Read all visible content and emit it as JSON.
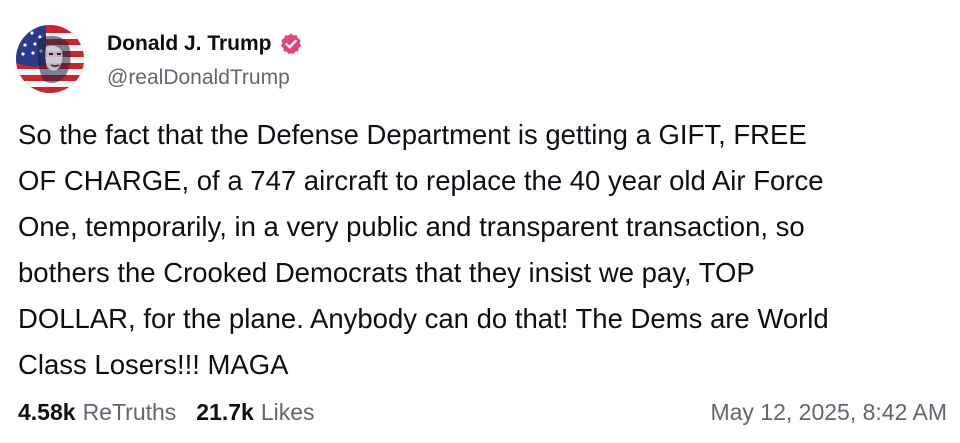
{
  "colors": {
    "verified_badge": "#e0457b",
    "handle_gray": "#616770",
    "text": "#0b0f14"
  },
  "author": {
    "display_name": "Donald J. Trump",
    "handle": "@realDonaldTrump",
    "avatar_icon": "avatar-flag-portrait",
    "verified_icon": "verified-badge-icon"
  },
  "post": {
    "text": "So the fact that the Defense Department is getting a GIFT, FREE OF CHARGE, of a 747 aircraft to replace the 40 year old Air Force One, temporarily, in a very public and transparent transaction, so bothers the Crooked Democrats that they insist we pay, TOP DOLLAR, for the plane. Anybody can do that! The Dems are World Class Losers!!! MAGA",
    "lines": [
      "So the fact that the Defense Department is getting a GIFT, FREE",
      "OF CHARGE, of a 747 aircraft to replace the 40 year old Air Force",
      "One, temporarily, in a very public and transparent transaction, so",
      "bothers the Crooked Democrats that they insist we pay, TOP",
      "DOLLAR, for the plane. Anybody can do that! The Dems are World",
      "Class Losers!!! MAGA"
    ]
  },
  "stats": {
    "retruths_count": "4.58k",
    "retruths_label": "ReTruths",
    "likes_count": "21.7k",
    "likes_label": "Likes"
  },
  "timestamp": "May 12, 2025, 8:42 AM"
}
